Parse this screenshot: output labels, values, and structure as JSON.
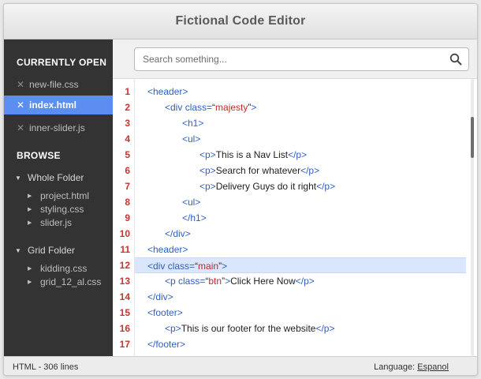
{
  "window": {
    "title": "Fictional Code Editor"
  },
  "sidebar": {
    "open_heading": "CURRENTLY OPEN",
    "open_files": [
      {
        "name": "new-file.css",
        "active": false
      },
      {
        "name": "index.html",
        "active": true
      },
      {
        "name": "inner-slider.js",
        "active": false
      }
    ],
    "browse_heading": "BROWSE",
    "folders": [
      {
        "name": "Whole Folder",
        "files": [
          "project.html",
          "styling.css",
          "slider.js"
        ]
      },
      {
        "name": "Grid Folder",
        "files": [
          "kidding.css",
          "grid_12_al.css"
        ]
      }
    ]
  },
  "search": {
    "placeholder": "Search something...",
    "value": ""
  },
  "editor": {
    "highlighted_line": 12,
    "lines": [
      {
        "n": "1",
        "tokens": [
          [
            "tag",
            "<header>"
          ]
        ]
      },
      {
        "n": "2",
        "tokens": [
          [
            "tag",
            "<div "
          ],
          [
            "attr",
            "class="
          ],
          [
            "txt",
            "“"
          ],
          [
            "val",
            "majesty"
          ],
          [
            "txt",
            "”"
          ],
          [
            "tag",
            ">"
          ]
        ]
      },
      {
        "n": "3",
        "tokens": [
          [
            "tag",
            "<h1>"
          ]
        ]
      },
      {
        "n": "4",
        "tokens": [
          [
            "tag",
            "<ul>"
          ]
        ]
      },
      {
        "n": "5",
        "tokens": [
          [
            "tag",
            "<p>"
          ],
          [
            "txt",
            "This is a Nav List"
          ],
          [
            "tag",
            "</p>"
          ]
        ]
      },
      {
        "n": "6",
        "tokens": [
          [
            "tag",
            "<p>"
          ],
          [
            "txt",
            "Search for whatever"
          ],
          [
            "tag",
            "</p>"
          ]
        ]
      },
      {
        "n": "7",
        "tokens": [
          [
            "tag",
            "<p>"
          ],
          [
            "txt",
            "Delivery Guys do it right"
          ],
          [
            "tag",
            "</p>"
          ]
        ]
      },
      {
        "n": "8",
        "tokens": [
          [
            "tag",
            "<ul>"
          ]
        ]
      },
      {
        "n": "9",
        "tokens": [
          [
            "tag",
            "</h1>"
          ]
        ]
      },
      {
        "n": "10",
        "tokens": [
          [
            "tag",
            "</div>"
          ]
        ]
      },
      {
        "n": "11",
        "tokens": [
          [
            "tag",
            "<header>"
          ]
        ]
      },
      {
        "n": "12",
        "tokens": [
          [
            "tag",
            "<div "
          ],
          [
            "attr",
            "class="
          ],
          [
            "txt",
            "“"
          ],
          [
            "val",
            "main"
          ],
          [
            "txt",
            "”"
          ],
          [
            "tag",
            ">"
          ]
        ]
      },
      {
        "n": "13",
        "tokens": [
          [
            "tag",
            "<p "
          ],
          [
            "attr",
            "class="
          ],
          [
            "txt",
            "“"
          ],
          [
            "val",
            "btn"
          ],
          [
            "txt",
            "”"
          ],
          [
            "tag",
            ">"
          ],
          [
            "txt",
            "Click Here Now"
          ],
          [
            "tag",
            "</p>"
          ]
        ]
      },
      {
        "n": "14",
        "tokens": [
          [
            "tag",
            "</div>"
          ]
        ]
      },
      {
        "n": "15",
        "tokens": [
          [
            "tag",
            "<footer>"
          ]
        ]
      },
      {
        "n": "16",
        "tokens": [
          [
            "tag",
            "<p>"
          ],
          [
            "txt",
            "This is our footer for the website"
          ],
          [
            "tag",
            "</p>"
          ]
        ]
      },
      {
        "n": "17",
        "tokens": [
          [
            "tag",
            "</footer>"
          ]
        ]
      }
    ]
  },
  "status": {
    "left": "HTML - 306 lines",
    "language_label": "Language: ",
    "language_value": "Espanol"
  },
  "colors": {
    "accent": "#5b8ef0",
    "line_number": "#d22f2f",
    "tag": "#2f5fbf",
    "attr_value": "#c32a2a",
    "highlight": "#d9e6fb",
    "sidebar_bg": "#333333"
  },
  "icons": {
    "search": "magnifier-icon",
    "close": "x-icon",
    "folder_toggle": "triangle-down-icon",
    "file_bullet": "triangle-right-icon"
  }
}
